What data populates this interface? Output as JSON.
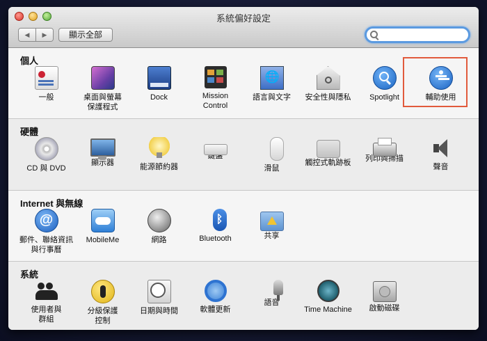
{
  "window": {
    "title": "系統偏好設定",
    "back_icon": "◀",
    "forward_icon": "▶",
    "show_all_label": "顯示全部",
    "search": {
      "value": "",
      "placeholder": ""
    }
  },
  "sections": {
    "personal": {
      "title": "個人",
      "items": [
        {
          "label": "一般",
          "icon": "general-icon"
        },
        {
          "label": "桌面與螢幕\n保護程式",
          "icon": "desktop-screensaver-icon"
        },
        {
          "label": "Dock",
          "icon": "dock-icon"
        },
        {
          "label": "Mission\nControl",
          "icon": "mission-control-icon"
        },
        {
          "label": "語言與文字",
          "icon": "language-text-icon"
        },
        {
          "label": "安全性與隱私",
          "icon": "security-privacy-icon"
        },
        {
          "label": "Spotlight",
          "icon": "spotlight-icon"
        },
        {
          "label": "輔助使用",
          "icon": "accessibility-icon"
        }
      ]
    },
    "hardware": {
      "title": "硬體",
      "items": [
        {
          "label": "CD 與 DVD",
          "icon": "cd-dvd-icon"
        },
        {
          "label": "顯示器",
          "icon": "displays-icon"
        },
        {
          "label": "能源節約器",
          "icon": "energy-saver-icon"
        },
        {
          "label": "鍵盤",
          "icon": "keyboard-icon"
        },
        {
          "label": "滑鼠",
          "icon": "mouse-icon"
        },
        {
          "label": "觸控式軌跡板",
          "icon": "trackpad-icon"
        },
        {
          "label": "列印與掃描",
          "icon": "print-scan-icon"
        },
        {
          "label": "聲音",
          "icon": "sound-icon"
        }
      ]
    },
    "internet": {
      "title": "Internet 與無線",
      "items": [
        {
          "label": "郵件、聯絡資訊\n與行事曆",
          "icon": "mail-contacts-calendars-icon"
        },
        {
          "label": "MobileMe",
          "icon": "mobileme-icon"
        },
        {
          "label": "網路",
          "icon": "network-icon"
        },
        {
          "label": "Bluetooth",
          "icon": "bluetooth-icon"
        },
        {
          "label": "共享",
          "icon": "sharing-icon"
        }
      ]
    },
    "system": {
      "title": "系統",
      "items": [
        {
          "label": "使用者與\n群組",
          "icon": "users-groups-icon"
        },
        {
          "label": "分級保護\n控制",
          "icon": "parental-controls-icon"
        },
        {
          "label": "日期與時間",
          "icon": "date-time-icon"
        },
        {
          "label": "軟體更新",
          "icon": "software-update-icon"
        },
        {
          "label": "語音",
          "icon": "speech-icon"
        },
        {
          "label": "Time Machine",
          "icon": "time-machine-icon"
        },
        {
          "label": "啟動磁碟",
          "icon": "startup-disk-icon"
        }
      ]
    }
  },
  "icon_glyphs": {
    "mail": "@",
    "bluetooth": "ᛒ"
  },
  "colors": {
    "highlight_border": "#e15a3c",
    "search_focus": "#5b9ae0"
  }
}
